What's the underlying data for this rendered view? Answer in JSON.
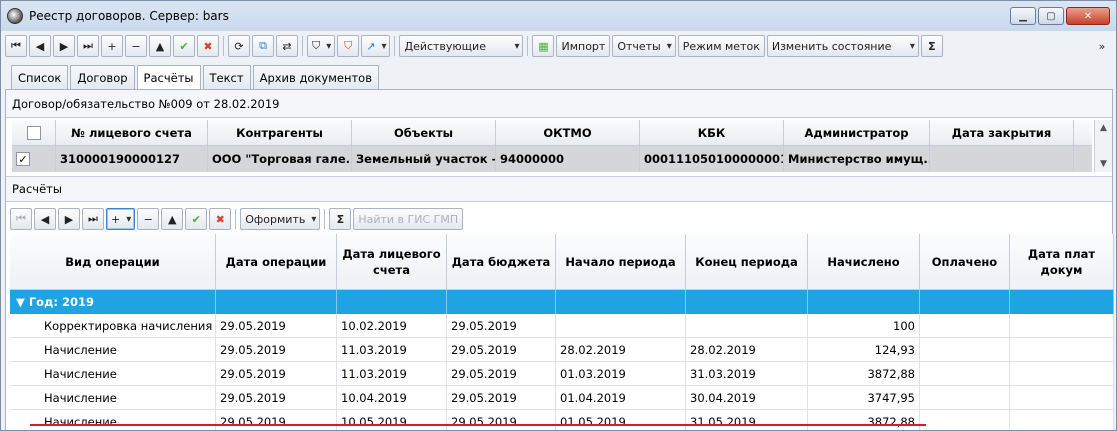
{
  "window": {
    "title": "Реестр договоров. Сервер: bars"
  },
  "toolbar": {
    "status_filter": "Действующие",
    "import_label": "Импорт",
    "reports_label": "Отчеты",
    "marks_mode_label": "Режим меток",
    "change_state_label": "Изменить состояние",
    "sum_label": "Σ",
    "more_label": "»"
  },
  "tabs": [
    {
      "label": "Список"
    },
    {
      "label": "Договор"
    },
    {
      "label": "Расчёты"
    },
    {
      "label": "Текст"
    },
    {
      "label": "Архив документов"
    }
  ],
  "contract": {
    "header": "Договор/обязательство №009 от 28.02.2019",
    "columns": [
      "",
      "№ лицевого счета",
      "Контрагенты",
      "Объекты",
      "ОКТМО",
      "КБК",
      "Администратор",
      "Дата закрытия"
    ],
    "row": {
      "checked": "✓",
      "account": "310000190000127",
      "counterparty": "ООО \"Торговая гале...",
      "object": "Земельный участок -...",
      "oktmo": "94000000",
      "kbk": "000111050100000001...",
      "admin": "Министерство имущ...",
      "close_date": ""
    }
  },
  "calc": {
    "section_title": "Расчёты",
    "format_label": "Оформить",
    "sum_label": "Σ",
    "find_gis_label": "Найти в ГИС ГМП",
    "columns": [
      "Вид операции",
      "Дата операции",
      "Дата лицевого счета",
      "Дата бюджета",
      "Начало периода",
      "Конец периода",
      "Начислено",
      "Оплачено",
      "Дата плат докум"
    ],
    "group_label": "Год: 2019",
    "rows": [
      {
        "op": "Корректировка начисления",
        "op_date": "29.05.2019",
        "acc_date": "10.02.2019",
        "budget_date": "29.05.2019",
        "start": "",
        "end": "",
        "accrued": "100",
        "paid": "",
        "pay_doc": ""
      },
      {
        "op": "Начисление",
        "op_date": "29.05.2019",
        "acc_date": "11.03.2019",
        "budget_date": "29.05.2019",
        "start": "28.02.2019",
        "end": "28.02.2019",
        "accrued": "124,93",
        "paid": "",
        "pay_doc": ""
      },
      {
        "op": "Начисление",
        "op_date": "29.05.2019",
        "acc_date": "11.03.2019",
        "budget_date": "29.05.2019",
        "start": "01.03.2019",
        "end": "31.03.2019",
        "accrued": "3872,88",
        "paid": "",
        "pay_doc": ""
      },
      {
        "op": "Начисление",
        "op_date": "29.05.2019",
        "acc_date": "10.04.2019",
        "budget_date": "29.05.2019",
        "start": "01.04.2019",
        "end": "30.04.2019",
        "accrued": "3747,95",
        "paid": "",
        "pay_doc": ""
      },
      {
        "op": "Начисление",
        "op_date": "29.05.2019",
        "acc_date": "10.05.2019",
        "budget_date": "29.05.2019",
        "start": "01.05.2019",
        "end": "31.05.2019",
        "accrued": "3872,88",
        "paid": "",
        "pay_doc": ""
      }
    ]
  },
  "colors": {
    "group_row": "#1fa3e2",
    "annotation_line": "#d11e1e"
  }
}
